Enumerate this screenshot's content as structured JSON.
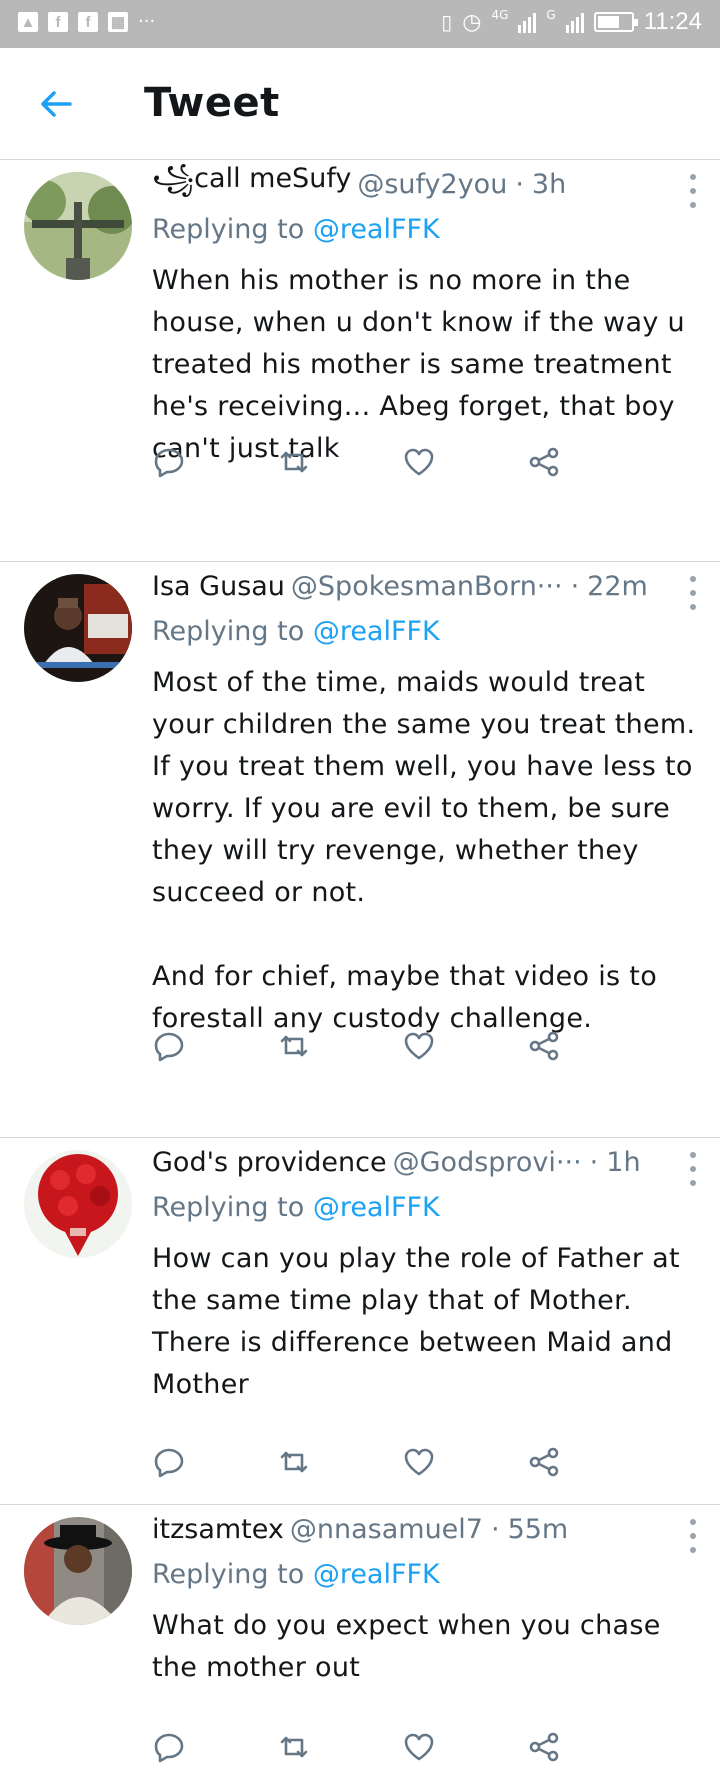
{
  "status_bar": {
    "left_icons": [
      "image-icon",
      "facebook-icon",
      "facebook-icon",
      "gallery-icon"
    ],
    "more": "···",
    "network_labels": [
      "4G",
      "4G",
      "G"
    ],
    "time": "11:24"
  },
  "header": {
    "title": "Tweet"
  },
  "tweets": [
    {
      "name": "꧁call meSufy",
      "handle": "@sufy2you",
      "time": "3h",
      "reply_prefix": "Replying to",
      "reply_user": "@realFFK",
      "text": "When his mother is no more in the house, when u don't know if the way u treated his mother is same treatment he's receiving... Abeg forget, that boy can't just talk"
    },
    {
      "name": "Isa Gusau",
      "handle": "@SpokesmanBorn···",
      "time": "22m",
      "reply_prefix": "Replying to",
      "reply_user": "@realFFK",
      "text": "Most of the time, maids would treat your children the same you treat them. If you treat them well, you have less to worry. If you are evil to them, be sure they will try revenge, whether they succeed or not.\n\nAnd for chief, maybe that video is to forestall any custody challenge."
    },
    {
      "name": "God's providence",
      "handle": "@Godsprovi···",
      "time": "1h",
      "reply_prefix": "Replying to",
      "reply_user": "@realFFK",
      "text": "How can you play the role of Father at the same time play that of Mother. There is difference between Maid and Mother"
    },
    {
      "name": "itzsamtex",
      "handle": "@nnasamuel7",
      "time": "55m",
      "reply_prefix": "Replying to",
      "reply_user": "@realFFK",
      "text": "What do you expect when you chase the mother out"
    }
  ],
  "colors": {
    "accent": "#1da1f2",
    "secondary_text": "#657786",
    "icon": "#657786",
    "divider": "#d6d9db"
  }
}
